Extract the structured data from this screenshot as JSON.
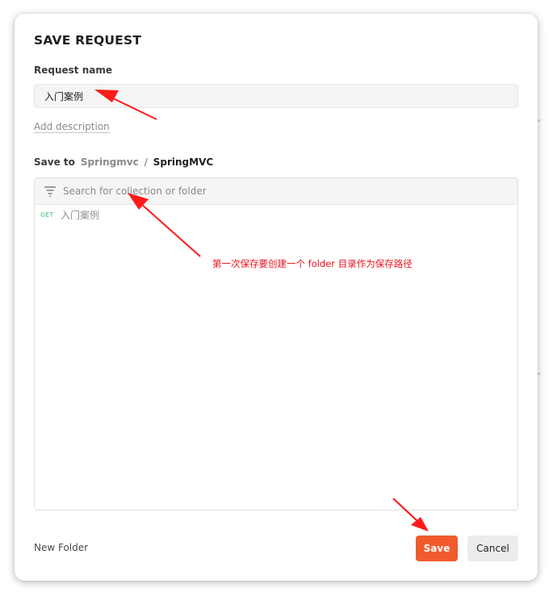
{
  "dialog": {
    "title": "SAVE REQUEST",
    "request_name_label": "Request name",
    "request_name_value": "入门案例",
    "add_description": "Add description",
    "save_to": {
      "label": "Save to",
      "breadcrumb_parent": "Springmvc",
      "separator": "/",
      "breadcrumb_current": "SpringMVC"
    },
    "search": {
      "placeholder": "Search for collection or folder",
      "icon": "filter-icon"
    },
    "items": [
      {
        "method": "GET",
        "name": "入门案例",
        "method_color": "#8cd3a9"
      }
    ],
    "new_folder": "New Folder",
    "save_button": "Save",
    "cancel_button": "Cancel"
  },
  "annotations": {
    "note": "第一次保存要创建一个 folder 目录作为保存路径",
    "color": "#e8121c"
  },
  "colors": {
    "accent": "#f05a2c",
    "annotation_red": "#e8121c"
  }
}
